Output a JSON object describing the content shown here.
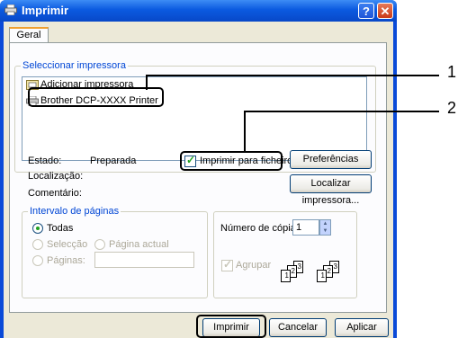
{
  "window": {
    "title": "Imprimir",
    "help_glyph": "?",
    "close_glyph": "✕"
  },
  "tabs": [
    {
      "label": "Geral"
    }
  ],
  "select_printer": {
    "group_label": "Seleccionar impressora",
    "items": [
      {
        "label": "Adicionar impressora",
        "icon": "add-printer-icon"
      },
      {
        "label": "Brother DCP-XXXX   Printer",
        "icon": "printer-icon"
      }
    ]
  },
  "status": {
    "estado_label": "Estado:",
    "estado_value": "Preparada",
    "localizacao_label": "Localização:",
    "comentario_label": "Comentário:"
  },
  "print_to_file": {
    "label": "Imprimir para ficheiro",
    "checked": true
  },
  "buttons": {
    "preferencias": "Preferências",
    "localizar": "Localizar impressora...",
    "imprimir": "Imprimir",
    "cancelar": "Cancelar",
    "aplicar": "Aplicar"
  },
  "page_range": {
    "group_label": "Intervalo de páginas",
    "todas": "Todas",
    "seleccao": "Selecção",
    "pagina_actual": "Página actual",
    "paginas": "Páginas:",
    "selected": "Todas"
  },
  "copies": {
    "label": "Número de cópias:",
    "value": "1",
    "agrupar_label": "Agrupar",
    "agrupar_checked": true
  },
  "collate_pages": [
    "1",
    "2",
    "3",
    "1",
    "2",
    "3"
  ],
  "callouts": {
    "one": "1",
    "two": "2"
  },
  "colors": {
    "titlebar": "#0b5ae0",
    "dialog_bg": "#ece9d8",
    "group_title": "#0046d5",
    "close_button": "#c93a18"
  }
}
